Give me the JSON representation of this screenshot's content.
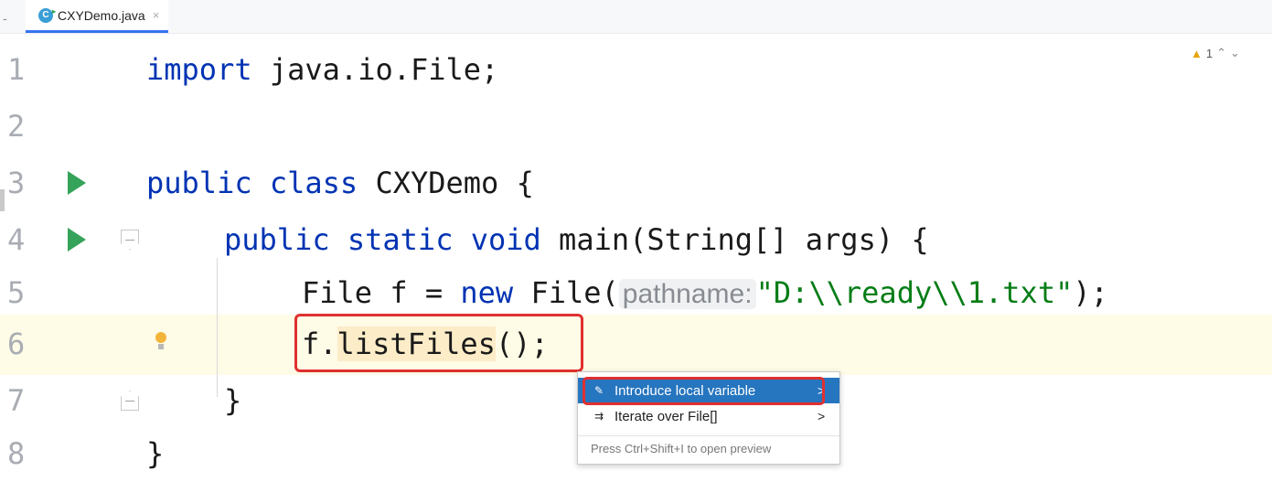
{
  "tab": {
    "dash": "-",
    "icon": "C",
    "label": "CXYDemo.java",
    "close": "×"
  },
  "warnings": {
    "count": "1"
  },
  "lines": [
    {
      "n": "1"
    },
    {
      "n": "2"
    },
    {
      "n": "3"
    },
    {
      "n": "4"
    },
    {
      "n": "5"
    },
    {
      "n": "6"
    },
    {
      "n": "7"
    },
    {
      "n": "8"
    }
  ],
  "code": {
    "l1_kw": "import",
    "l1_rest": " java.io.File;",
    "l3_kw": "public class",
    "l3_rest": " CXYDemo {",
    "l4_kw": "public static void",
    "l4_rest": " main(String[] args) {",
    "l5_a": "File f = ",
    "l5_kw": "new",
    "l5_b": " File(",
    "l5_hint": "pathname:",
    "l5_str": "\"D:\\\\ready\\\\1.txt\"",
    "l5_c": ");",
    "l6_a": "f.",
    "l6_call": "listFiles",
    "l6_b": "();",
    "l7": "}",
    "l8": "}"
  },
  "popup": {
    "items": [
      {
        "label": "Introduce local variable",
        "arrow": ">"
      },
      {
        "label": "Iterate over File[]",
        "arrow": ">"
      }
    ],
    "footer": "Press Ctrl+Shift+I to open preview"
  }
}
